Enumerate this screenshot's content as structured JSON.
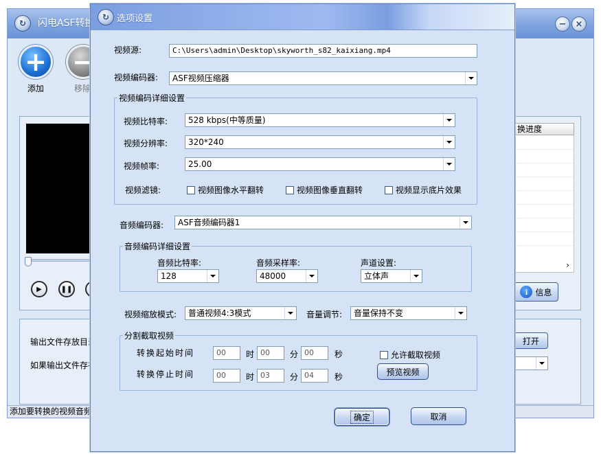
{
  "background_window": {
    "title": "闪电ASF转换器",
    "toolbar": {
      "add_label": "添加",
      "remove_label": "移除"
    },
    "list_header": "换进度",
    "info_button": "信息",
    "open_button": "打开",
    "output_label": "输出文件存放目录",
    "output_exists_label": "如果输出文件存在",
    "status_text": "添加要转换的视频音频"
  },
  "dialog": {
    "title": "选项设置",
    "video_source": {
      "label": "视频源:",
      "value": "C:\\Users\\admin\\Desktop\\skyworth_s82_kaixiang.mp4"
    },
    "video_encoder": {
      "label": "视频编码器:",
      "value": "ASF视频压缩器"
    },
    "video_detail": {
      "legend": "视频编码详细设置",
      "bitrate": {
        "label": "视频比特率:",
        "value": "528 kbps(中等质量)"
      },
      "resolution": {
        "label": "视频分辨率:",
        "value": "320*240"
      },
      "framerate": {
        "label": "视频帧率:",
        "value": "25.00"
      },
      "filter": {
        "label": "视频滤镜:",
        "hflip": "视频图像水平翻转",
        "vflip": "视频图像垂直翻转",
        "negative": "视频显示底片效果"
      }
    },
    "audio_encoder": {
      "label": "音频编码器:",
      "value": "ASF音频编码器1"
    },
    "audio_detail": {
      "legend": "音频编码详细设置",
      "bitrate": {
        "label": "音频比特率:",
        "value": "128"
      },
      "samplerate": {
        "label": "音频采样率:",
        "value": "48000"
      },
      "channels": {
        "label": "声道设置:",
        "value": "立体声"
      }
    },
    "scale_mode": {
      "label": "视频缩放模式:",
      "value": "普通视频4:3模式"
    },
    "volume": {
      "label": "音量调节:",
      "value": "音量保持不变"
    },
    "clip": {
      "legend": "分割截取视频",
      "start_label": "转换起始时间",
      "stop_label": "转换停止时间",
      "hour": "时",
      "minute": "分",
      "second": "秒",
      "start": {
        "h": "00",
        "m": "00",
        "s": "00"
      },
      "stop": {
        "h": "00",
        "m": "03",
        "s": "04"
      },
      "allow_clip": "允许截取视频",
      "preview_button": "预览视频"
    },
    "ok_button": "确定",
    "cancel_button": "取消"
  },
  "colors": {
    "dialog_bg": "#d6e3f6",
    "title_blue": "#7b9ee0",
    "border": "#7f9db9"
  }
}
